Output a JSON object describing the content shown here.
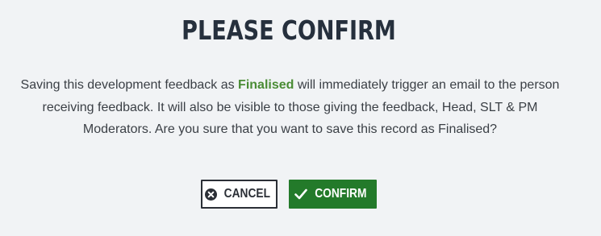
{
  "dialog": {
    "title": "PLEASE CONFIRM",
    "message_before": "Saving this development feedback as ",
    "status_word": "Finalised",
    "message_after": " will immediately trigger an email to the person receiving feedback. It will also be visible to those giving the feedback, Head, SLT & PM Moderators. Are you sure that you want to save this record as Finalised?"
  },
  "buttons": {
    "cancel_label": "CANCEL",
    "cancel_icon": "circle-x-icon",
    "confirm_label": "CONFIRM",
    "confirm_icon": "checkmark-icon"
  },
  "colors": {
    "background": "#f1f3f5",
    "title": "#26303d",
    "status_word": "#4a8c35",
    "confirm_button": "#237a2a",
    "cancel_border": "#2b2f36"
  }
}
